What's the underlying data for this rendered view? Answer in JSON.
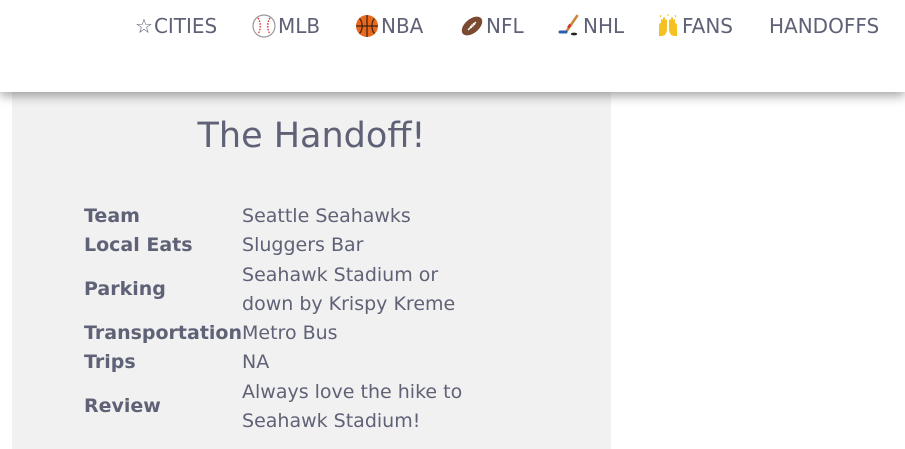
{
  "nav": {
    "items": [
      {
        "label": "CITIES",
        "icon": "star-icon"
      },
      {
        "label": "MLB",
        "icon": "baseball-icon"
      },
      {
        "label": "NBA",
        "icon": "basketball-icon"
      },
      {
        "label": "NFL",
        "icon": "football-icon"
      },
      {
        "label": "NHL",
        "icon": "hockey-icon"
      },
      {
        "label": "FANS",
        "icon": "raised-hands-icon"
      },
      {
        "label": "HANDOFFS",
        "icon": ""
      }
    ]
  },
  "card": {
    "title": "The Handoff!",
    "rows": [
      {
        "label": "Team",
        "value": "Seattle Seahawks"
      },
      {
        "label": "Local Eats",
        "value": "Sluggers Bar"
      },
      {
        "label": "Parking",
        "value": "Seahawk Stadium or down by Krispy Kreme"
      },
      {
        "label": "Transportation",
        "value": "Metro Bus"
      },
      {
        "label": "Trips",
        "value": "NA"
      },
      {
        "label": "Review",
        "value": "Always love the hike to Seahawk Stadium!"
      }
    ]
  },
  "colors": {
    "text": "#5f6276",
    "card_background": "#f1f1f1",
    "page_background": "#ffffff",
    "basketball": "#e8691c",
    "football": "#7a4a33",
    "baseball_stitch": "#d9312b",
    "hands": "#f5c022"
  }
}
